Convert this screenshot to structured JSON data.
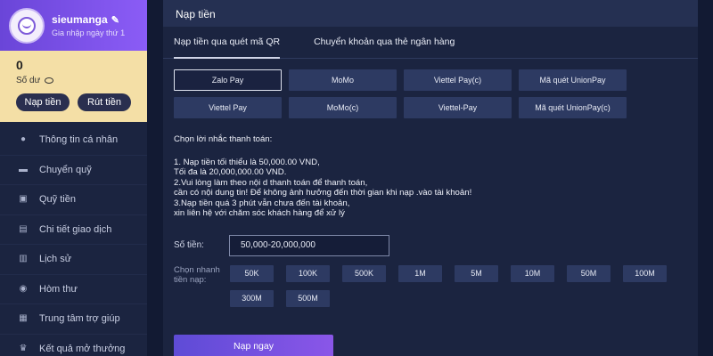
{
  "profile": {
    "username": "sieumanga",
    "joined": "Gia nhập ngày thứ 1"
  },
  "wallet": {
    "balance": "0",
    "balance_label": "Số dư",
    "deposit_label": "Nạp tiền",
    "withdraw_label": "Rút tiền"
  },
  "menu": [
    {
      "label": "Thông tin cá nhân",
      "icon": "user-icon"
    },
    {
      "label": "Chuyển quỹ",
      "icon": "wallet-icon"
    },
    {
      "label": "Quỹ tiền",
      "icon": "fund-icon"
    },
    {
      "label": "Chi tiết giao dịch",
      "icon": "document-icon"
    },
    {
      "label": "Lịch sử",
      "icon": "history-icon"
    },
    {
      "label": "Hòm thư",
      "icon": "mailbox-icon"
    },
    {
      "label": "Trung tâm trợ giúp",
      "icon": "help-icon"
    },
    {
      "label": "Kết quả mở thưởng",
      "icon": "trophy-icon"
    }
  ],
  "main": {
    "title": "Nạp tiền",
    "tabs": [
      "Nạp tiền qua quét mã QR",
      "Chuyển khoản qua thẻ ngân hàng"
    ],
    "methods": [
      "Zalo Pay",
      "MoMo",
      "Viettel Pay(c)",
      "Mã quét UnionPay",
      "Viettel Pay",
      "MoMo(c)",
      "Viettel-Pay",
      "Mã quét UnionPay(c)"
    ],
    "notes_title": "Chọn lời nhắc thanh toán:",
    "notes": [
      "1. Nạp tiền tối thiểu là 50,000.00 VND,",
      "Tối đa là 20,000,000.00 VND.",
      "2.Vui lòng làm theo nội d thanh toán để thanh toán,",
      "cần có nội dung tin! Để không ảnh hưởng đến thời gian khi nạp .vào tài khoản!",
      "3.Nạp tiền quá 3 phút vẫn chưa đến tài khoản,",
      "xin liên hệ với chăm sóc khách hàng để xử lý"
    ],
    "amount_label": "Số tiền:",
    "amount_placeholder": "50,000-20,000,000",
    "quick_label": "Chọn nhanh tiền nạp:",
    "quick_amounts": [
      "50K",
      "100K",
      "500K",
      "1M",
      "5M",
      "10M",
      "50M",
      "100M",
      "300M",
      "500M"
    ],
    "submit_label": "Nạp ngay"
  }
}
